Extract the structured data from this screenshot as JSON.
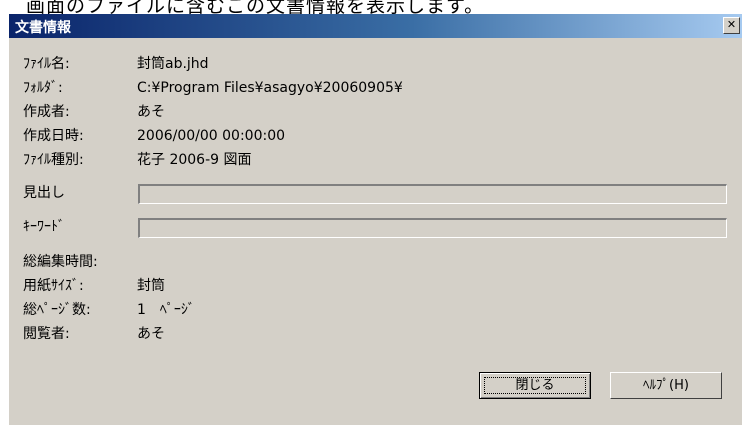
{
  "caption": "画面のファイルに含むこの文書情報を表示します。",
  "dialog": {
    "title": "文書情報",
    "close_glyph": "✕"
  },
  "info": {
    "filename_label": "ﾌｧｲﾙ名:",
    "filename_value": "封筒ab.jhd",
    "folder_label": "ﾌｫﾙﾀﾞ:",
    "folder_value": "C:¥Program Files¥asagyo¥20060905¥",
    "author_label": "作成者:",
    "author_value": "あそ",
    "created_label": "作成日時:",
    "created_value": "2006/00/00 00:00:00",
    "filetype_label": "ﾌｧｲﾙ種別:",
    "filetype_value": "花子 2006-9 図面"
  },
  "fields": {
    "heading_label": "見出し",
    "heading_value": "",
    "keyword_label": "ｷｰﾜｰﾄﾞ",
    "keyword_value": ""
  },
  "stats": {
    "edit_time_label": "総編集時間:",
    "edit_time_value": "",
    "paper_size_label": "用紙ｻｲｽﾞ:",
    "paper_size_value": "封筒",
    "page_count_label": "総ﾍﾟｰｼﾞ数:",
    "page_count_value": "1　ﾍﾟｰｼﾞ",
    "viewer_label": "閲覧者:",
    "viewer_value": "あそ"
  },
  "buttons": {
    "close_label": "閉じる",
    "help_label": "ﾍﾙﾌﾟ(H)"
  }
}
